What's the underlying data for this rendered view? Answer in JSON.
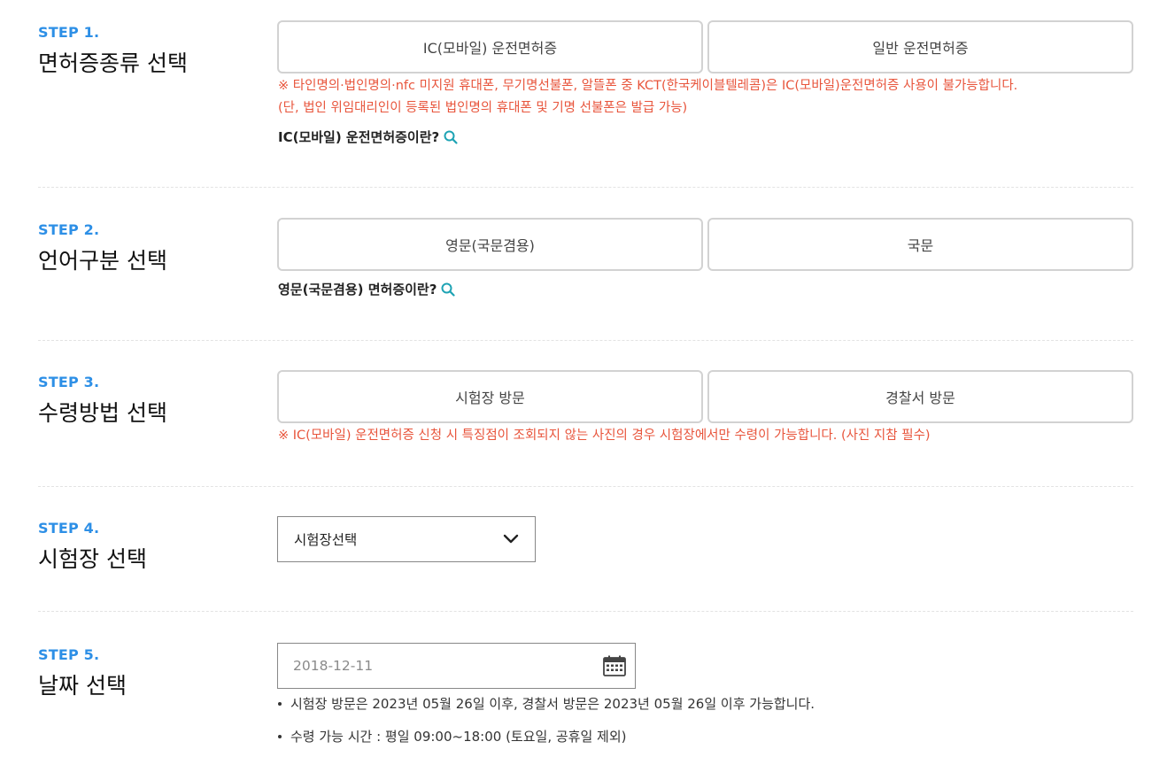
{
  "steps": [
    {
      "num": "STEP 1.",
      "title": "면허증종류 선택",
      "options": [
        "IC(모바일) 운전면허증",
        "일반 운전면허증"
      ],
      "warnings": [
        "※ 타인명의·법인명의·nfc 미지원 휴대폰, 무기명선불폰, 알뜰폰 중 KCT(한국케이블텔레콤)은 IC(모바일)운전면허증 사용이 불가능합니다.",
        "(단, 법인 위임대리인이 등록된 법인명의 휴대폰 및 기명 선불폰은 발급 가능)"
      ],
      "info_link": "IC(모바일) 운전면허증이란?"
    },
    {
      "num": "STEP 2.",
      "title": "언어구분 선택",
      "options": [
        "영문(국문겸용)",
        "국문"
      ],
      "info_link": "영문(국문겸용) 면허증이란?"
    },
    {
      "num": "STEP 3.",
      "title": "수령방법 선택",
      "options": [
        "시험장 방문",
        "경찰서 방문"
      ],
      "warning": "※ IC(모바일) 운전면허증 신청 시 특징점이 조회되지 않는 사진의 경우 시험장에서만 수령이 가능합니다. (사진 지참 필수)"
    },
    {
      "num": "STEP 4.",
      "title": "시험장 선택",
      "select_value": "시험장선택"
    },
    {
      "num": "STEP 5.",
      "title": "날짜 선택",
      "date_value": "2018-12-11",
      "notes": [
        "시험장 방문은 2023년 05월 26일 이후, 경찰서 방문은 2023년 05월 26일 이후 가능합니다.",
        "수령 가능 시간 : 평일 09:00~18:00 (토요일, 공휴일 제외)"
      ]
    }
  ],
  "colors": {
    "step_accent": "#2d8fe6",
    "warning": "#e8553c",
    "info_icon": "#1ea3b4",
    "border": "#d2d2d2"
  },
  "icons": {
    "info": "search-icon",
    "select": "chevron-down-icon",
    "date": "calendar-icon"
  }
}
